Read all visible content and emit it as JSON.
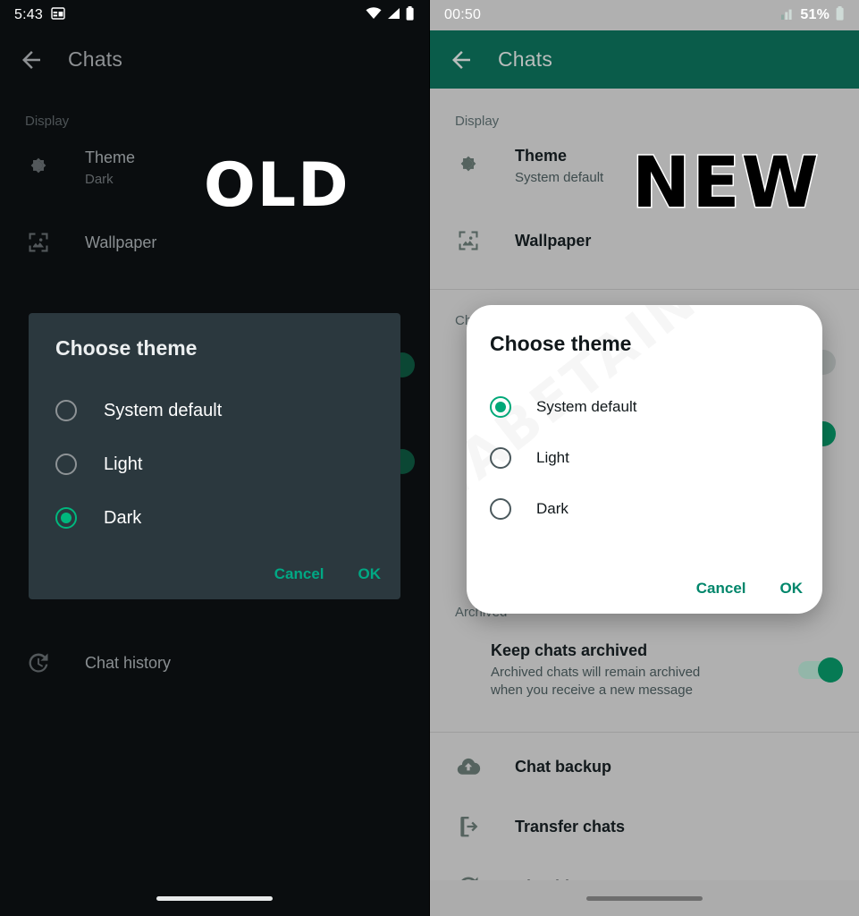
{
  "old_phone": {
    "status_bar": {
      "time": "5:43",
      "icons": [
        "calendar-icon",
        "wifi-icon",
        "signal-icon",
        "battery-icon"
      ]
    },
    "app_bar": {
      "back": "back-arrow-icon",
      "title": "Chats"
    },
    "sections": [
      {
        "label": "Display"
      }
    ],
    "rows": [
      {
        "icon": "theme-brightness-icon",
        "title": "Theme",
        "subtitle": "Dark"
      },
      {
        "icon": "wallpaper-icon",
        "title": "Wallpaper",
        "subtitle": ""
      },
      {
        "icon": "chat-history-icon",
        "title": "Chat history",
        "subtitle": ""
      }
    ],
    "badge": "OLD",
    "dialog": {
      "title": "Choose theme",
      "options": [
        {
          "label": "System default",
          "selected": false
        },
        {
          "label": "Light",
          "selected": false
        },
        {
          "label": "Dark",
          "selected": true
        }
      ],
      "cancel": "Cancel",
      "ok": "OK"
    },
    "colors": {
      "background": "#0a0d0f",
      "dialog": "#2b383e",
      "accent": "#00a884"
    }
  },
  "new_phone": {
    "status_bar": {
      "time": "00:50",
      "battery_percent": "51%",
      "icons": [
        "signal-icon",
        "battery-icon"
      ]
    },
    "app_bar": {
      "back": "back-arrow-icon",
      "title": "Chats"
    },
    "sections": [
      {
        "label": "Display"
      },
      {
        "label": "Chat settings"
      },
      {
        "label": "Archived"
      }
    ],
    "rows": [
      {
        "icon": "theme-brightness-icon",
        "title": "Theme",
        "subtitle": "System default"
      },
      {
        "icon": "wallpaper-icon",
        "title": "Wallpaper",
        "subtitle": ""
      },
      {
        "icon": "",
        "title": "Keep chats archived",
        "subtitle": "Archived chats will remain archived\nwhen you receive a new message",
        "toggle": true
      },
      {
        "icon": "chat-backup-icon",
        "title": "Chat backup",
        "subtitle": ""
      },
      {
        "icon": "transfer-chats-icon",
        "title": "Transfer chats",
        "subtitle": ""
      },
      {
        "icon": "chat-history-icon",
        "title": "Chat history",
        "subtitle": ""
      }
    ],
    "badge": "NEW",
    "dialog": {
      "title": "Choose theme",
      "options": [
        {
          "label": "System default",
          "selected": true
        },
        {
          "label": "Light",
          "selected": false
        },
        {
          "label": "Dark",
          "selected": false
        }
      ],
      "cancel": "Cancel",
      "ok": "OK"
    },
    "watermark": "WABETAINFO",
    "colors": {
      "background": "#b0b0b0",
      "header": "#0a5c4a",
      "dialog": "#ffffff",
      "accent": "#00866b"
    }
  }
}
